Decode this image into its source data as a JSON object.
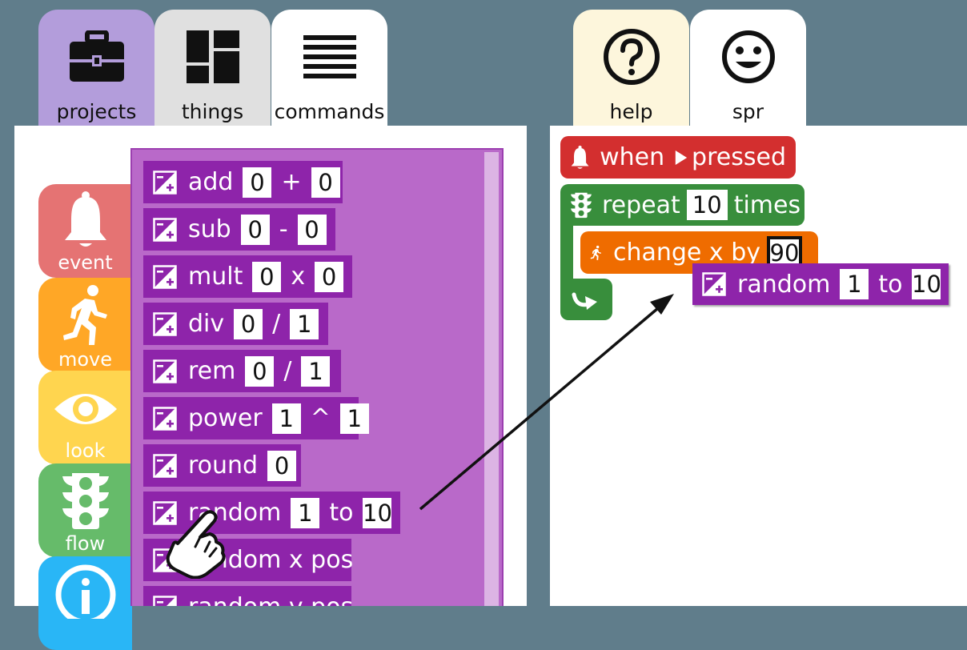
{
  "tabs": {
    "projects": "projects",
    "things": "things",
    "commands": "commands",
    "help": "help",
    "sprite": "spr"
  },
  "categories": {
    "event": "event",
    "move": "move",
    "look": "look",
    "flow": "flow"
  },
  "palette": {
    "add": {
      "label": "add",
      "a": "0",
      "op": "+",
      "b": "0"
    },
    "sub": {
      "label": "sub",
      "a": "0",
      "op": "-",
      "b": "0"
    },
    "mult": {
      "label": "mult",
      "a": "0",
      "op": "x",
      "b": "0"
    },
    "div": {
      "label": "div",
      "a": "0",
      "op": "/",
      "b": "1"
    },
    "rem": {
      "label": "rem",
      "a": "0",
      "op": "/",
      "b": "1"
    },
    "power": {
      "label": "power",
      "a": "1",
      "op": "^",
      "b": "1"
    },
    "round": {
      "label": "round",
      "a": "0"
    },
    "random": {
      "label": "random",
      "a": "1",
      "op": "to",
      "b": "10"
    },
    "random_x": {
      "label": "random x pos"
    },
    "random_y": {
      "label": "random y pos"
    }
  },
  "script": {
    "when": {
      "label": "when",
      "suffix": "pressed"
    },
    "repeat": {
      "label": "repeat",
      "count": "10",
      "suffix": "times"
    },
    "change_x": {
      "label": "change x by",
      "value": "90"
    },
    "random": {
      "label": "random",
      "a": "1",
      "op": "to",
      "b": "10"
    }
  },
  "colors": {
    "background": "#607d8b",
    "operator_block": "#8e24aa",
    "palette_bg": "#b969c9",
    "event": "#e57373",
    "move": "#ffa726",
    "look": "#ffd54f",
    "flow": "#66bb6a",
    "info": "#29b6f6",
    "event_block": "#d32f2f",
    "flow_block": "#388e3c",
    "move_block": "#ef6c00"
  },
  "icons": [
    "briefcase-icon",
    "dashboard-icon",
    "menu-lines-icon",
    "help-circle-icon",
    "smiley-icon",
    "bell-icon",
    "run-icon",
    "eye-icon",
    "traffic-light-icon",
    "info-icon",
    "calc-icon",
    "play-icon",
    "loop-arrow-icon",
    "hand-pointer-icon"
  ]
}
